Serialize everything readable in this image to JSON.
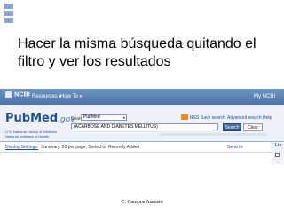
{
  "slide": {
    "title": "Hacer la misma búsqueda quitando el filtro y ver los resultados",
    "footer": "C. Campos Asensio"
  },
  "ncbi_header": {
    "logo": "NCBI",
    "menu_resources": "Resources",
    "menu_howto": "How To",
    "right_link": "My NCBI"
  },
  "pubmed": {
    "logo_main": "PubMed",
    "logo_suffix": ".gov",
    "library_line1": "U.S. National Library of Medicine",
    "library_line2": "National Institutes of Health",
    "search_label": "Search:",
    "database_selected": "PubMed",
    "links": {
      "rss": "RSS",
      "save_search": "Save search",
      "advanced_search": "Advanced search",
      "help": "Help"
    },
    "query_value": "(ACARBOSE AND DIABETES MELLITUS)",
    "search_button": "Search",
    "clear_button": "Clear"
  },
  "results": {
    "display_settings": "Display Settings:",
    "summary": "Summary, 20 per page, Sorted by Recently Added",
    "send_to": "Send to:",
    "side_label": "Lin"
  },
  "colors": {
    "bullet": "#8aa6cf",
    "ncbi_bar": "#4b74a8",
    "pubmed_logo": "#1f4f8f",
    "rss": "#f08a24"
  }
}
